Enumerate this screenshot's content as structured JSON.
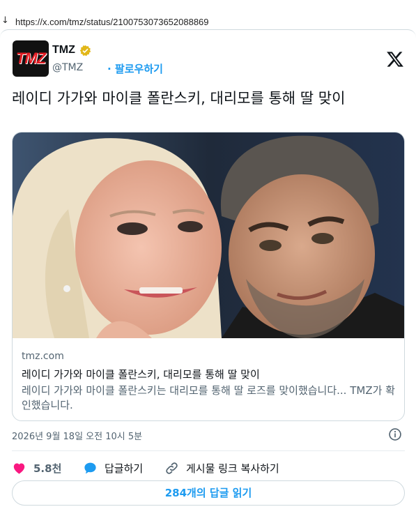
{
  "browser": {
    "url": "https://x.com/tmz/status/2100753073652088869"
  },
  "tweet": {
    "author": {
      "name": "TMZ",
      "handle": "@TMZ",
      "follow_label": "· 팔로우하기",
      "avatar_text": "TMZ"
    },
    "text": "레이디 가가와 마이클 폴란스키, 대리모를 통해 딸 맞이",
    "link_card": {
      "domain": "tmz.com",
      "title": "레이디 가가와 마이클 폴란스키, 대리모를 통해 딸 맞이",
      "description": "레이디 가가와 마이클 폴란스키는 대리모를 통해 딸 로즈를 맞이했습니다... TMZ가 확인했습니다."
    },
    "timestamp": "2026년 9월 18일 오전 10시 5분",
    "actions": {
      "like_count": "5.8천",
      "reply_label": "답글하기",
      "copy_label": "게시물 링크 복사하기"
    },
    "read_replies_label": "284개의 답글 읽기"
  },
  "colors": {
    "accent": "#1d9bf0",
    "like": "#f91880",
    "verified": "#e2b719"
  }
}
